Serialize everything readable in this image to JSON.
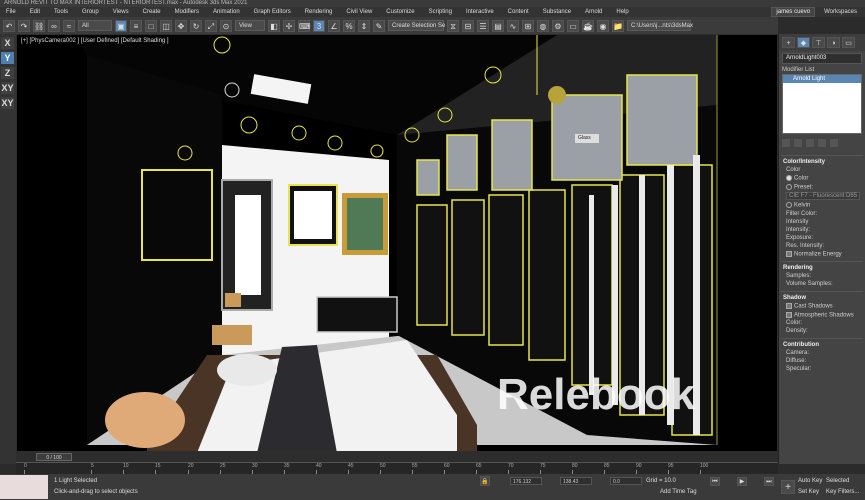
{
  "window": {
    "title": "ARNOLD REVIT TO MAX INTERIORTEST - NTERIORTEST.max - Autodesk 3ds Max 2021"
  },
  "menu": {
    "items": [
      "File",
      "Edit",
      "Tools",
      "Group",
      "Views",
      "Create",
      "Modifiers",
      "Animation",
      "Graph Editors",
      "Rendering",
      "Civil View",
      "Customize",
      "Scripting",
      "Interactive",
      "Content",
      "Substance",
      "Arnold",
      "Help"
    ],
    "user": "james cuevo",
    "workspace_label": "Workspaces"
  },
  "toolbar": {
    "filter": "All",
    "view": "View",
    "selection_set": "Create Selection Se",
    "path": "C:\\Users\\j...nts\\3dsMax"
  },
  "axes": [
    "X",
    "Y",
    "Z",
    "XY",
    "XY"
  ],
  "viewport": {
    "label": "[+] [PhysCamera002 ] [User Defined] [Default Shading ]",
    "glass_label": "Glass",
    "watermark": "Relebook"
  },
  "command_panel": {
    "object_name": "ArnoldLight003",
    "modifier_list_label": "Modifier List",
    "modifier_item": "Arnold Light",
    "color_section": {
      "title": "Color/Intensity",
      "color_label": "Color",
      "color_option": "Color",
      "preset_option": "Preset:",
      "preset_value": "CIE F7 - Fluorescent D65",
      "kelvin_option": "Kelvin",
      "filter_color": "Filter Color:",
      "intensity_label": "Intensity",
      "intensity": "Intensity:",
      "exposure": "Exposure:",
      "res_intensity": "Res. Intensity:",
      "normalize": "Normalize Energy"
    },
    "rendering_section": {
      "title": "Rendering",
      "samples": "Samples:",
      "volume_samples": "Volume Samples:"
    },
    "shadow_section": {
      "title": "Shadow",
      "cast": "Cast Shadows",
      "atmospheric": "Atmospheric Shadows",
      "color": "Color:",
      "density": "Density:"
    },
    "contribution_section": {
      "title": "Contribution",
      "camera": "Camera:",
      "diffuse": "Diffuse:",
      "specular": "Specular:"
    }
  },
  "timeline": {
    "frame": "0 / 100",
    "ticks": [
      "0",
      "5",
      "10",
      "15",
      "20",
      "25",
      "30",
      "35",
      "40",
      "45",
      "50",
      "55",
      "60",
      "65",
      "70",
      "75",
      "80",
      "85",
      "90",
      "95",
      "100"
    ]
  },
  "status": {
    "selected": "1 Light Selected",
    "prompt": "Click-and-drag to select objects",
    "x": "176.132",
    "y": "138.43",
    "z": "0.0",
    "grid": "Grid = 10.0",
    "add_time_tag": "Add Time Tag",
    "auto_key": "Auto Key",
    "selected_label": "Selected",
    "set_key": "Set Key",
    "key_filters": "Key Filters..."
  },
  "colors": {
    "selection_yellow": "#e8e54a",
    "panel_bg": "#444444",
    "accent_blue": "#5a86b5"
  }
}
